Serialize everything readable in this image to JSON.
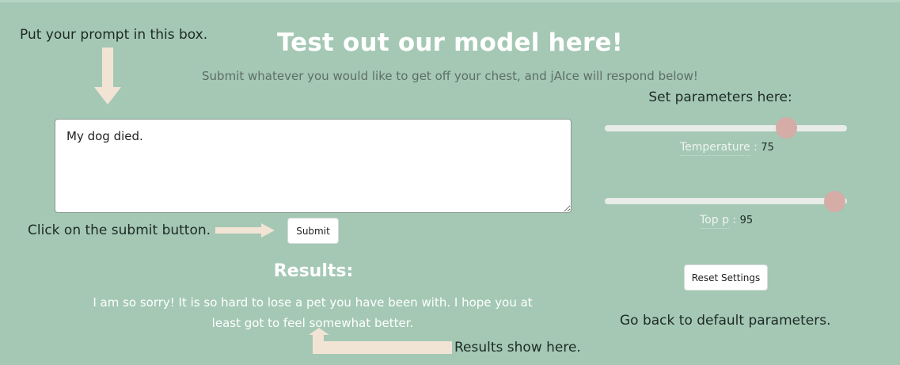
{
  "annotations": {
    "prompt_hint": "Put your prompt in this box.",
    "submit_hint": "Click on the submit button.",
    "reset_hint": "Go back to default parameters.",
    "results_hint": "Results show here."
  },
  "header": {
    "title": "Test out our model here!",
    "subtitle": "Submit whatever you would like to get off your chest, and jAIce will respond below!"
  },
  "prompt": {
    "value": "My dog died."
  },
  "submit_label": "Submit",
  "results": {
    "heading": "Results:",
    "text": "I am so sorry! It is so hard to lose a pet you have been with. I hope you at least got to feel somewhat better."
  },
  "parameters": {
    "heading": "Set parameters here:",
    "temperature": {
      "label": "Temperature",
      "separator": " :",
      "value": "75",
      "fraction": 0.75
    },
    "top_p": {
      "label": "Top p",
      "separator": " :",
      "value": "95",
      "fraction": 0.95
    },
    "reset_label": "Reset Settings"
  },
  "colors": {
    "background": "#a4c8b4",
    "arrow": "#f2e4d5",
    "slider_knob": "#d5aca6",
    "slider_track": "#e8ece9"
  },
  "icons": {
    "down_arrow": "down-arrow-icon",
    "right_arrow": "right-arrow-icon",
    "curved_arrow": "curved-up-arrow-icon"
  }
}
